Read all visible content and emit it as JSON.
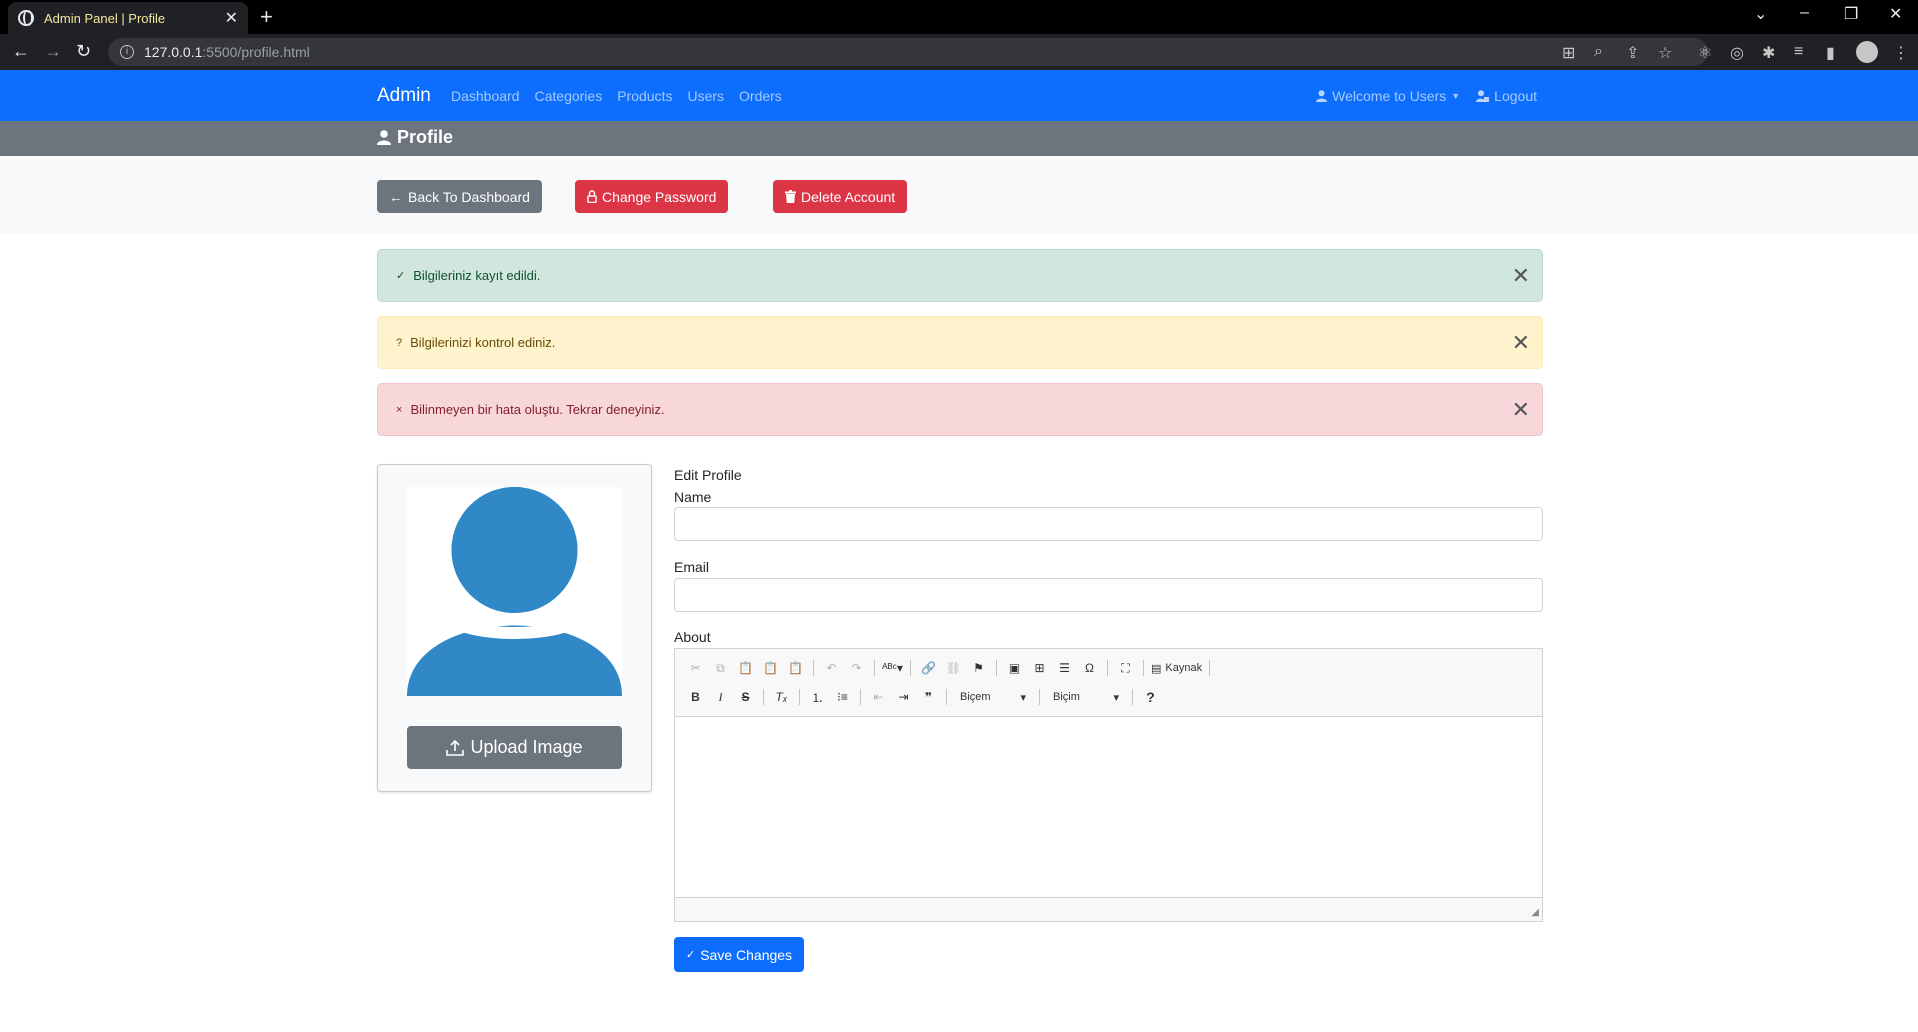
{
  "browser": {
    "tab_title": "Admin Panel | Profile",
    "url_host": "127.0.0.1",
    "url_rest": ":5500/profile.html"
  },
  "navbar": {
    "brand": "Admin",
    "links": [
      "Dashboard",
      "Categories",
      "Products",
      "Users",
      "Orders"
    ],
    "welcome": "Welcome to Users",
    "logout": "Logout",
    "color": "#0d6efd"
  },
  "page": {
    "title": "Profile"
  },
  "actions": {
    "back": "Back To Dashboard",
    "change_password": "Change Password",
    "delete_account": "Delete Account"
  },
  "alerts": {
    "success": {
      "icon": "✓",
      "text": "Bilgileriniz kayıt edildi."
    },
    "warning": {
      "icon": "?",
      "text": "Bilgilerinizi kontrol ediniz."
    },
    "danger": {
      "icon": "×",
      "text": "Bilinmeyen bir hata oluştu. Tekrar deneyiniz."
    }
  },
  "profile_card": {
    "upload_label": "Upload Image",
    "avatar_color": "#3088c7"
  },
  "form": {
    "title": "Edit Profile",
    "name_label": "Name",
    "name_value": "",
    "email_label": "Email",
    "email_value": "",
    "about_label": "About",
    "source_label": "Kaynak",
    "style_combo": "Biçem",
    "format_combo": "Biçim",
    "save_label": "Save Changes"
  }
}
